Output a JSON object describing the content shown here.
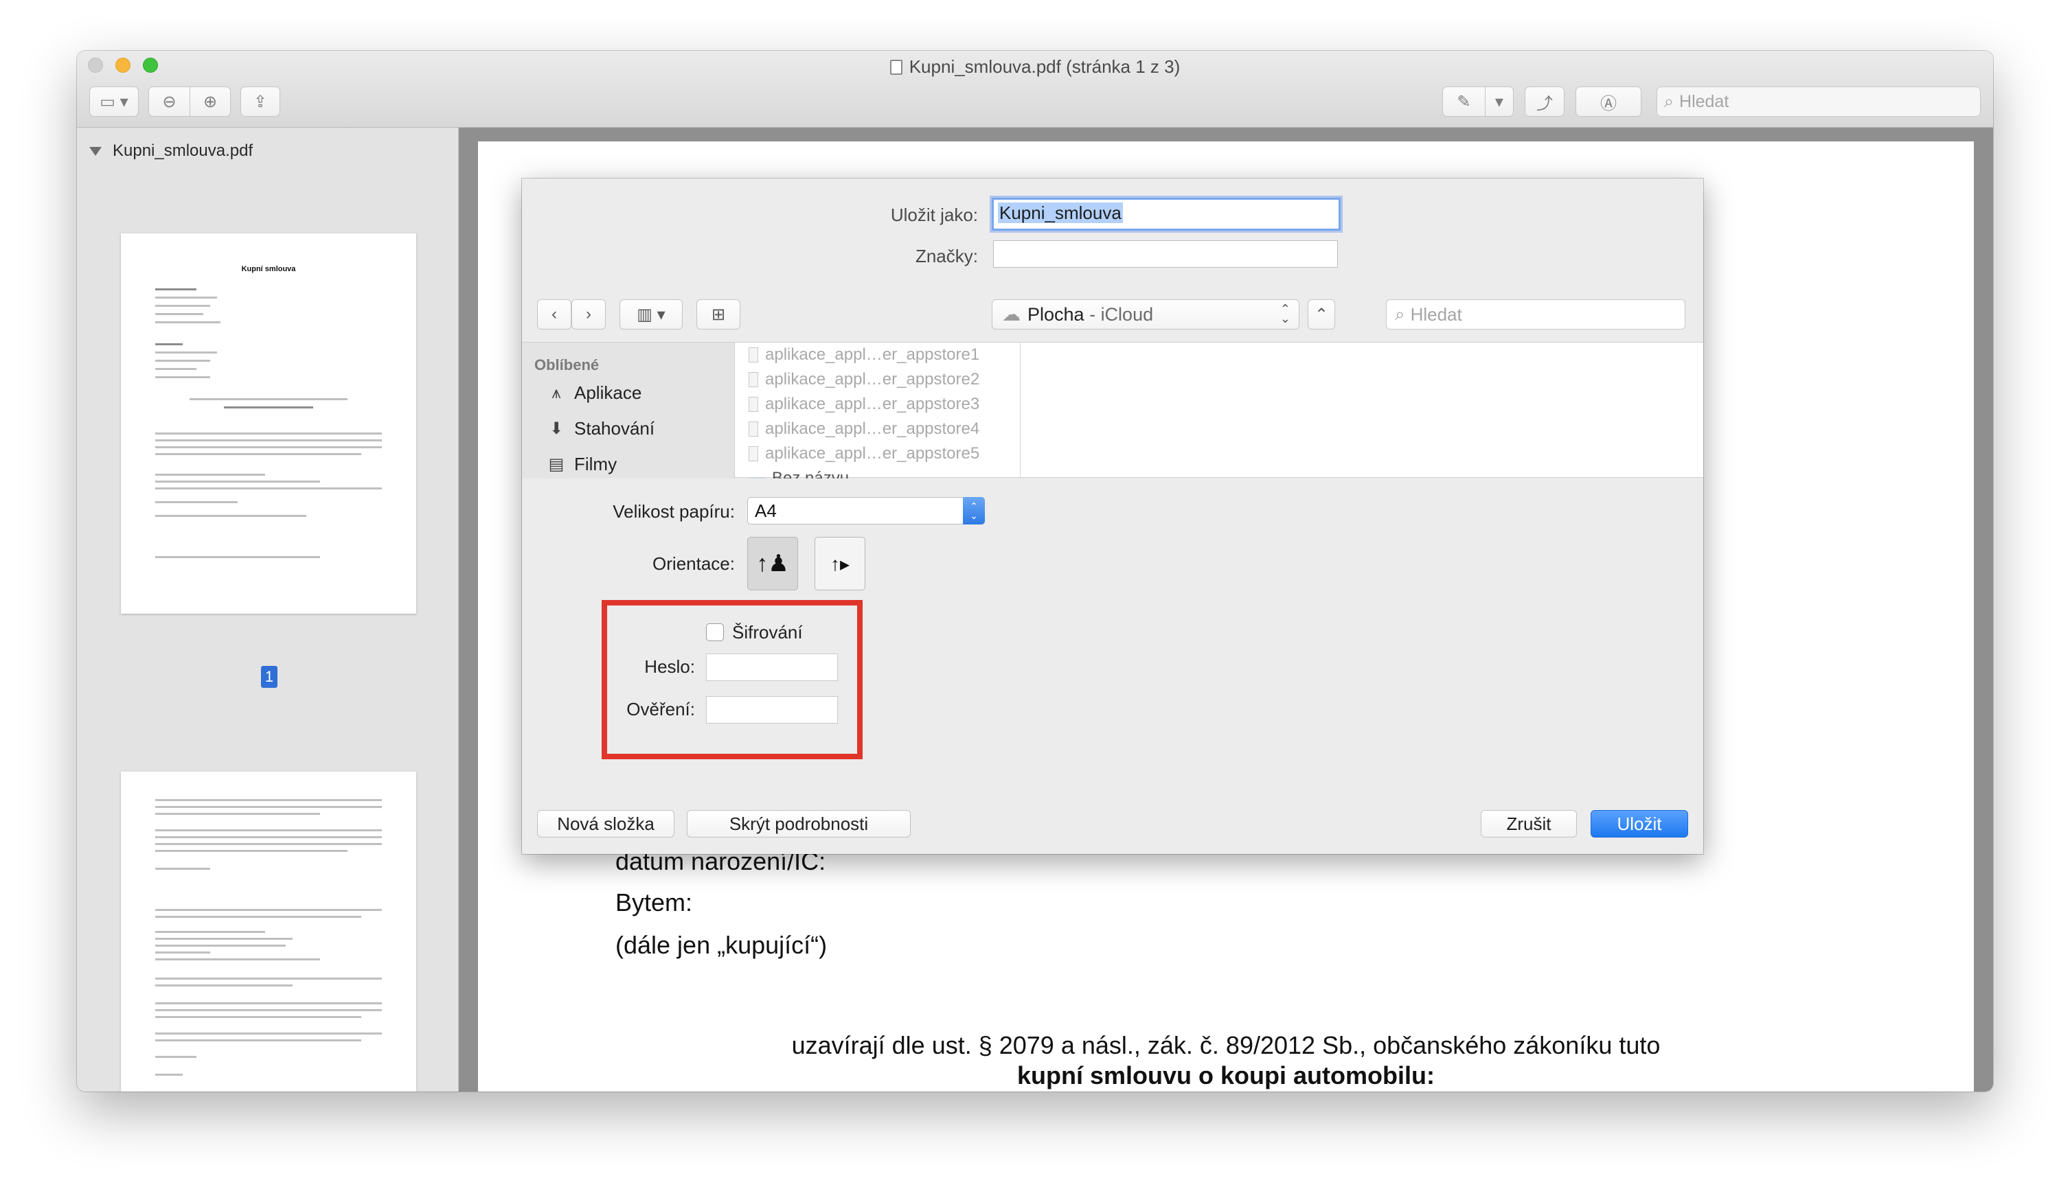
{
  "window": {
    "title": "Kupni_smlouva.pdf (stránka 1 z 3)"
  },
  "toolbar": {
    "search_placeholder": "Hledat"
  },
  "sidebar": {
    "file_name": "Kupni_smlouva.pdf",
    "thumb_title": "Kupní smlouva",
    "page_badge": "1"
  },
  "document": {
    "line1": "datum narození/IČ:",
    "line2": "Bytem:",
    "line3": "(dále jen „kupující“)",
    "line4": "uzavírají dle ust. § 2079 a násl., zák. č. 89/2012 Sb., občanského zákoníku tuto",
    "line5": "kupní smlouvu o koupi automobilu:"
  },
  "save_dialog": {
    "save_as_label": "Uložit jako:",
    "save_as_value": "Kupni_smlouva",
    "tags_label": "Značky:",
    "location_name": "Plocha",
    "location_sep": " - ",
    "location_service": "iCloud",
    "search_placeholder": "Hledat",
    "favorites_header": "Oblíbené",
    "favorites": [
      "Aplikace",
      "Stahování",
      "Filmy"
    ],
    "files": [
      "aplikace_appl…er_appstore1",
      "aplikace_appl…er_appstore2",
      "aplikace_appl…er_appstore3",
      "aplikace_appl…er_appstore4",
      "aplikace_appl…er_appstore5",
      "Bez názvu"
    ],
    "paper_size_label": "Velikost papíru:",
    "paper_size_value": "A4",
    "orientation_label": "Orientace:",
    "encryption_label": "Šifrování",
    "password_label": "Heslo:",
    "verify_label": "Ověření:",
    "new_folder_label": "Nová složka",
    "hide_details_label": "Skrýt podrobnosti",
    "cancel_label": "Zrušit",
    "save_label": "Uložit"
  },
  "colors": {
    "accent": "#1f78f0",
    "highlight_box": "#e0352b"
  }
}
